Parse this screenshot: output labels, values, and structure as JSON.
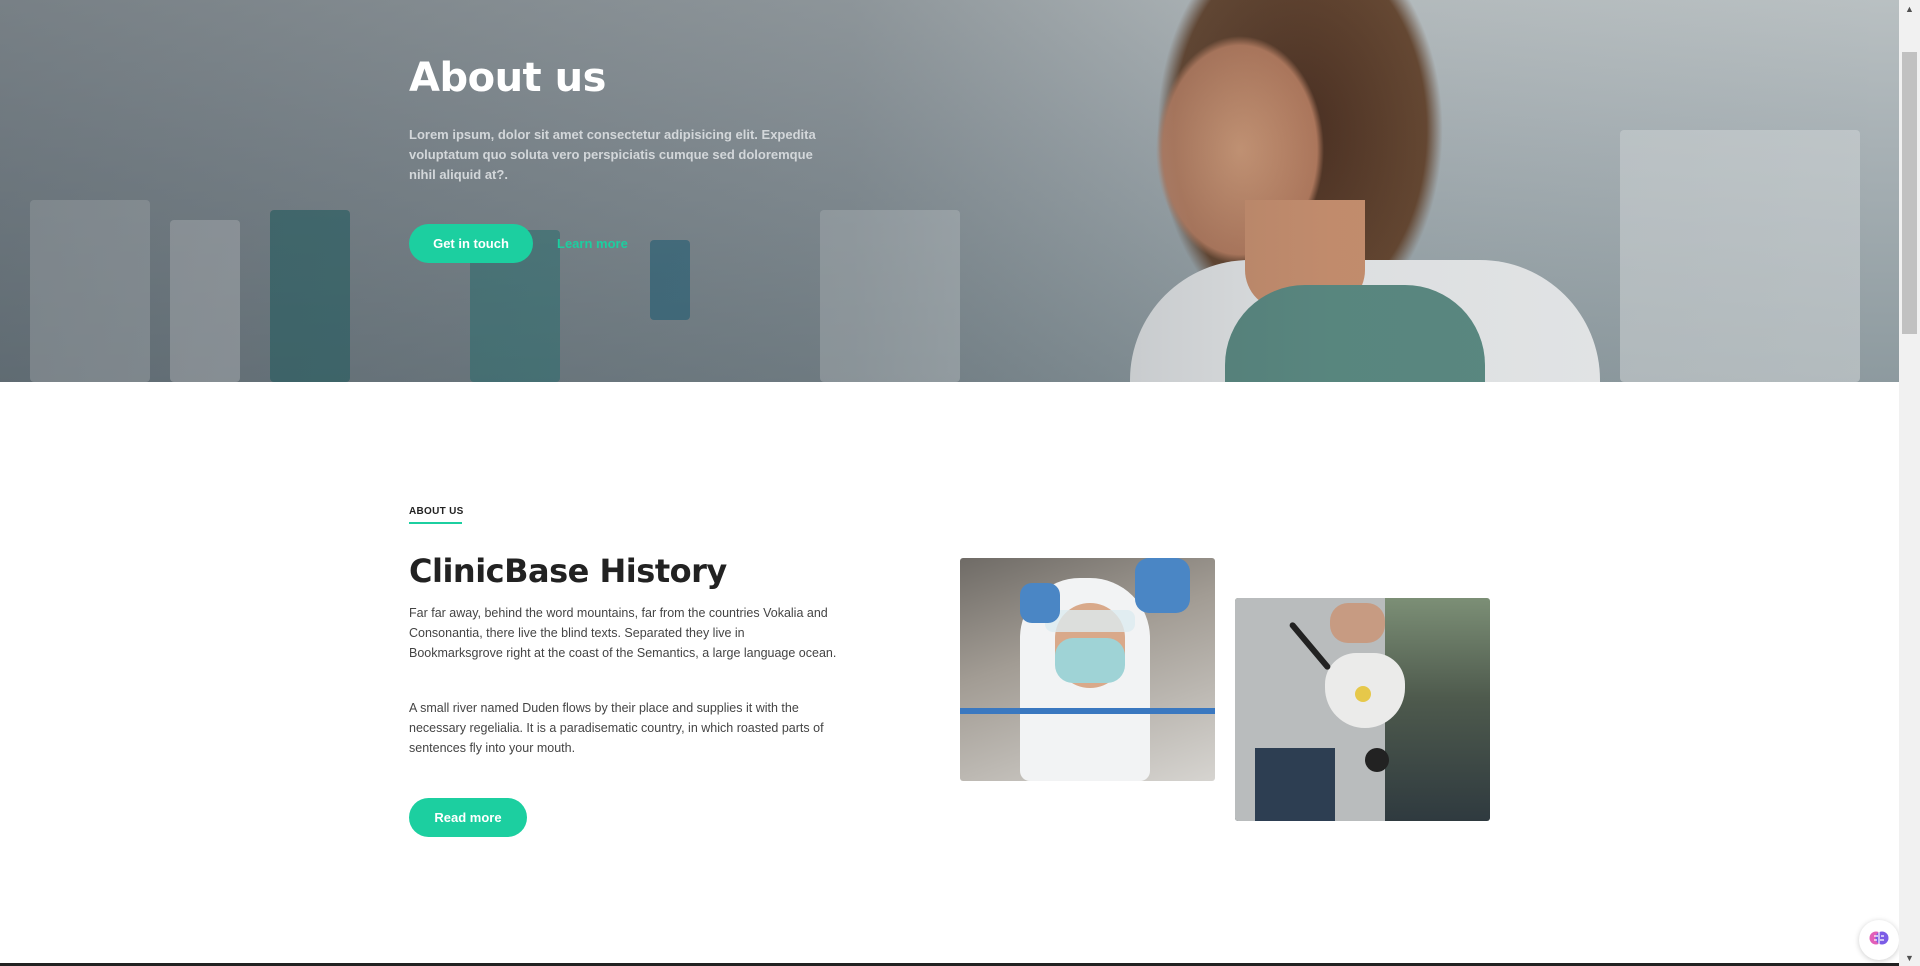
{
  "hero": {
    "title": "About us",
    "text": "Lorem ipsum, dolor sit amet consectetur adipisicing elit. Expedita voluptatum quo soluta vero perspiciatis cumque sed doloremque nihil aliquid at?.",
    "primary_button": "Get in touch",
    "secondary_link": "Learn more"
  },
  "about": {
    "eyebrow": "ABOUT US",
    "title": "ClinicBase History",
    "paragraph1": "Far far away, behind the word mountains, far from the countries Vokalia and Consonantia, there live the blind texts. Separated they live in Bookmarksgrove right at the coast of the Semantics, a large language ocean.",
    "paragraph2": "A small river named Duden flows by their place and supplies it with the necessary regelialia. It is a paradisematic country, in which roasted parts of sentences fly into your mouth.",
    "button": "Read more"
  },
  "colors": {
    "accent": "#1ccfa0",
    "heading": "#222222"
  },
  "icons": {
    "widget": "brain-icon",
    "scroll_up": "scroll-up-arrow-icon",
    "scroll_down": "scroll-down-arrow-icon"
  }
}
